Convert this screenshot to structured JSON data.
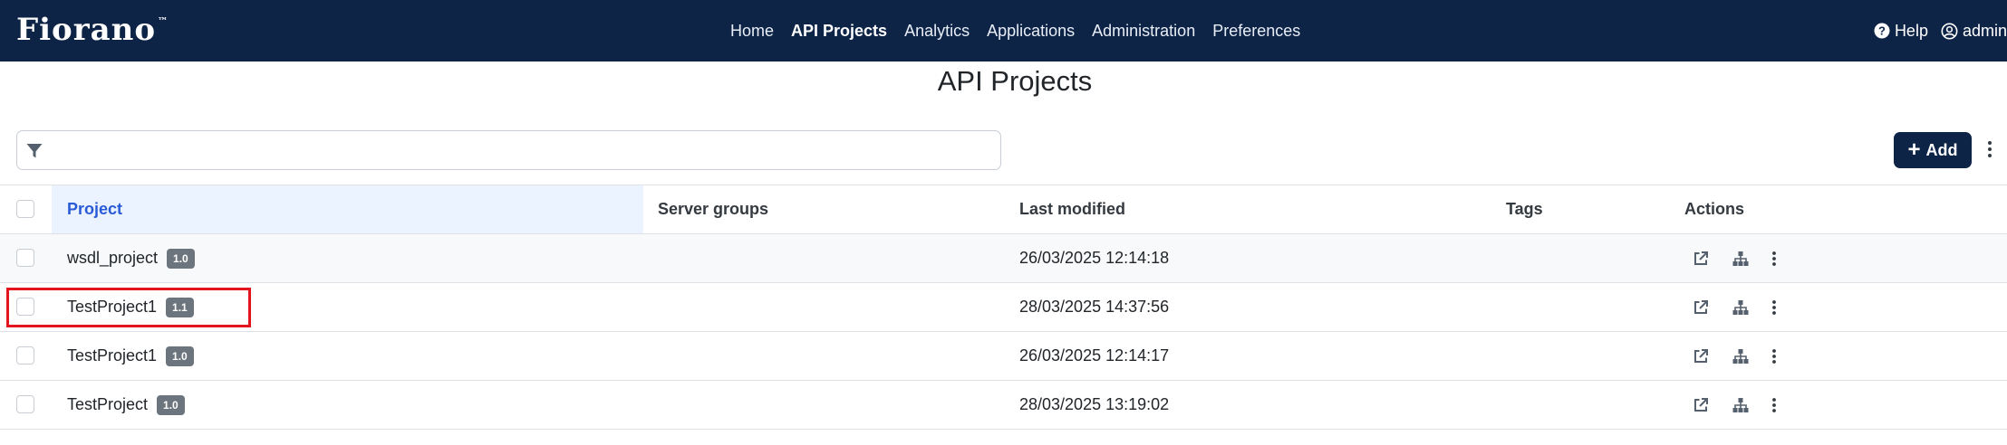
{
  "brand": {
    "logo_text": "Fiorano",
    "logo_mark": "™"
  },
  "nav": {
    "items": [
      {
        "label": "Home",
        "active": false
      },
      {
        "label": "API Projects",
        "active": true
      },
      {
        "label": "Analytics",
        "active": false
      },
      {
        "label": "Applications",
        "active": false
      },
      {
        "label": "Administration",
        "active": false
      },
      {
        "label": "Preferences",
        "active": false
      }
    ],
    "help_label": "Help",
    "user_label": "admin"
  },
  "page": {
    "title": "API Projects"
  },
  "filter": {
    "value": "",
    "placeholder": ""
  },
  "toolbar": {
    "add_label": "Add"
  },
  "table": {
    "columns": {
      "project": "Project",
      "server_groups": "Server groups",
      "last_modified": "Last modified",
      "tags": "Tags",
      "actions": "Actions"
    },
    "rows": [
      {
        "name": "wsdl_project",
        "version": "1.0",
        "server_groups": "",
        "last_modified": "26/03/2025 12:14:18",
        "tags": ""
      },
      {
        "name": "TestProject1",
        "version": "1.1",
        "server_groups": "",
        "last_modified": "28/03/2025 14:37:56",
        "tags": ""
      },
      {
        "name": "TestProject1",
        "version": "1.0",
        "server_groups": "",
        "last_modified": "26/03/2025 12:14:17",
        "tags": ""
      },
      {
        "name": "TestProject",
        "version": "1.0",
        "server_groups": "",
        "last_modified": "28/03/2025 13:19:02",
        "tags": ""
      }
    ]
  },
  "icons": {
    "filter": "filter-icon",
    "help": "question-circle-icon",
    "user": "user-circle-icon",
    "open": "external-link-icon",
    "hierarchy": "hierarchy-icon",
    "more": "kebab-icon"
  },
  "colors": {
    "navbar": "#0d2447",
    "add_button": "#0d2447",
    "active_column_header": "#2a5bd7",
    "badge": "#6c757d",
    "highlight": "#e3141c"
  }
}
